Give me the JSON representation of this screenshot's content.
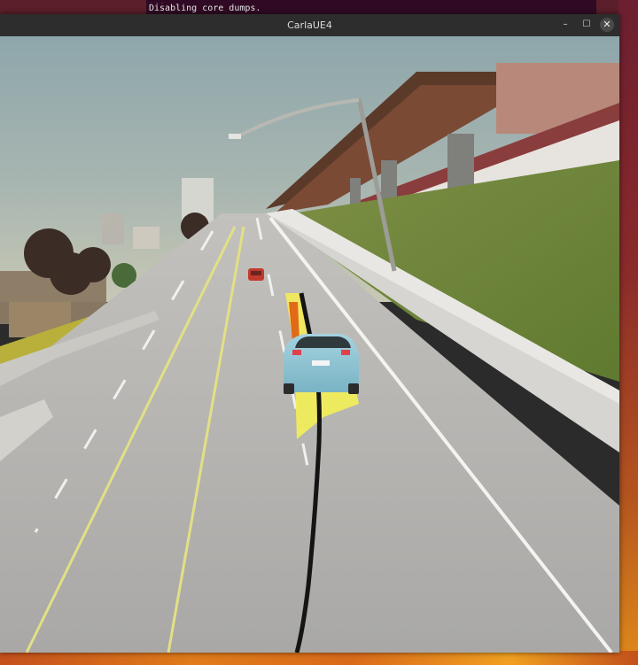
{
  "terminal": {
    "partial_line": "...",
    "line": "Disabling core dumps."
  },
  "window": {
    "title": "CarlaUE4",
    "controls": {
      "minimize": "–",
      "maximize": "☐",
      "close": "✕"
    }
  },
  "scene": {
    "description_icons": [
      "street-lamp-icon",
      "ego-vehicle-icon"
    ],
    "colors": {
      "sky": "#9fb0ad",
      "road": "#b7b5b2",
      "grass": "#6f8a3c",
      "ego_car": "#8fc3d3",
      "lead_car": "#c23a2e",
      "trajectory": "#141414",
      "highlight_yellow": "#f4ef55",
      "highlight_orange": "#e26a1a"
    }
  }
}
